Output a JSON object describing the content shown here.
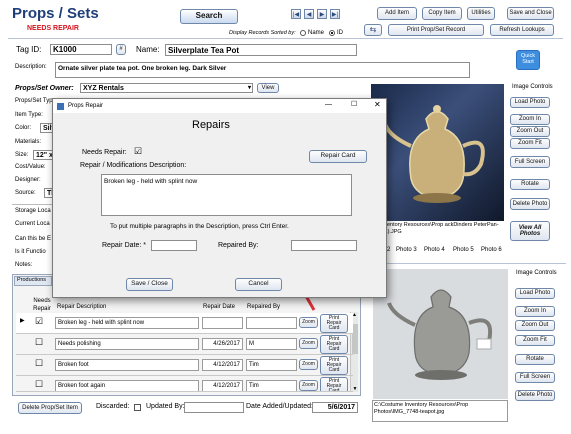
{
  "app": {
    "title": "Props / Sets",
    "status": "NEEDS REPAIR",
    "search_label": "Search",
    "sort_label": "Display Records Sorted by:",
    "sort_options": [
      "Name",
      "ID"
    ],
    "nav_icons": [
      "first-icon",
      "prev-icon",
      "next-icon",
      "last-icon"
    ],
    "nav_glyphs": [
      "|◀",
      "◀",
      "▶",
      "▶|"
    ],
    "toolbar": {
      "add": "Add Item",
      "copy": "Copy Item",
      "utilities": "Utilities",
      "save_close": "Save and Close",
      "print": "Print Prop/Set Record",
      "refresh": "Refresh Lookups",
      "filter_glyph": "⇆"
    }
  },
  "record": {
    "tag_label": "Tag ID:",
    "tag_value": "K1000",
    "hash_label": "#",
    "name_label": "Name:",
    "name_value": "Silverplate Tea Pot",
    "description_label": "Description:",
    "description_value": "Ornate silver plate tea pot.  One broken leg. Dark Silver",
    "quick_start": "Quick Start",
    "owner_label": "Props/Set Owner:",
    "owner_value": "XYZ Rentals",
    "view_label": "View",
    "side_labels": [
      "Props/Set Typ",
      "Item Type:",
      "Color:",
      "Materials:",
      "Size:",
      "Cost/Value:",
      "Designer:",
      "Source:",
      "Storage Loca",
      "Current Loca",
      "Can this be E",
      "Is it Functio",
      "Notes:"
    ],
    "color_partial": "Silv",
    "size_partial": "12\" x",
    "source_partial": "Tl"
  },
  "productions_tab": "Productions",
  "repairs_grid": {
    "headers": [
      "Needs Repair",
      "Repair Description",
      "Repair Date",
      "Repaired By"
    ],
    "rows": [
      {
        "checked": "☑",
        "description": "Broken leg - held with splint now",
        "date": "",
        "by": ""
      },
      {
        "checked": "☐",
        "description": "Needs polishing",
        "date": "4/26/2017",
        "by": "M"
      },
      {
        "checked": "☐",
        "description": "Broken foot",
        "date": "4/12/2017",
        "by": "Tim"
      },
      {
        "checked": "☐",
        "description": "Broken foot again",
        "date": "4/12/2017",
        "by": "Tim"
      }
    ],
    "zoom_label": "Zoom",
    "print_card_label": "Print Repair Card",
    "current_row_marker": "▶"
  },
  "footer": {
    "delete_label": "Delete Prop/Set Item",
    "discarded_label": "Discarded:",
    "updated_by_label": "Updated By:",
    "date_label": "Date Added/Updated:",
    "date_value": "5/6/2017"
  },
  "photos_top": {
    "caption": "ne Inventory Resources\\Prop ackDinders PeterPan-2nd (1).JPG",
    "tabs": [
      "2",
      "Photo 3",
      "Photo 4",
      "Photo 5",
      "Photo 6"
    ]
  },
  "image_controls_top": {
    "title": "Image Controls",
    "buttons": [
      "Load Photo",
      "Zoom In",
      "Zoom Out",
      "Zoom Fit",
      "Full Screen",
      "Rotate",
      "Delete Photo",
      "View All Photos"
    ]
  },
  "photos_bottom": {
    "caption": "C:\\Costume Inventory Resources\\Prop Photos\\IMG_7748-teapot.jpg"
  },
  "image_controls_bottom": {
    "title": "Image Controls",
    "buttons": [
      "Load Photo",
      "Zoom In",
      "Zoom Out",
      "Zoom Fit",
      "Rotate",
      "Full Screen",
      "Delete Photo"
    ]
  },
  "modal": {
    "window_title": "Props Repair",
    "heading": "Repairs",
    "needs_repair_label": "Needs Repair:",
    "needs_repair_checked": "☑",
    "desc_label": "Repair / Modifications Description:",
    "desc_value": "Broken leg - held with splint now",
    "repair_card_label": "Repair Card",
    "hint": "To put multiple paragraphs in the Description, press Ctrl Enter.",
    "repair_date_label": "Repair Date: *",
    "repair_date_value": "",
    "repaired_by_label": "Repaired By:",
    "repaired_by_value": "",
    "save_close_label": "Save / Close",
    "cancel_label": "Cancel",
    "window_controls": [
      "—",
      "☐",
      "✕"
    ]
  },
  "colors": {
    "title_blue": "#1f3f7a",
    "status_red": "#d4141c",
    "arrow_red": "#e0303a",
    "quickstart_blue": "#3e8ee0"
  }
}
